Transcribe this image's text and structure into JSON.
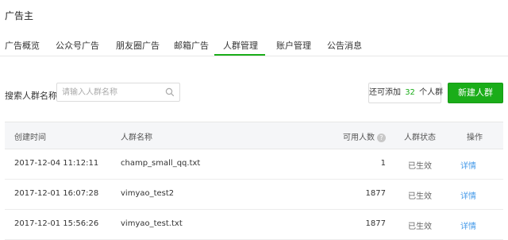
{
  "header": {
    "title": "广告主"
  },
  "nav": {
    "tabs": [
      {
        "label": "广告概览"
      },
      {
        "label": "公众号广告"
      },
      {
        "label": "朋友圈广告"
      },
      {
        "label": "邮箱广告"
      },
      {
        "label": "人群管理",
        "active": true
      },
      {
        "label": "账户管理"
      },
      {
        "label": "公告消息"
      }
    ]
  },
  "search": {
    "label": "搜索人群名称",
    "placeholder": "请输入人群名称"
  },
  "quota": {
    "prefix": "还可添加",
    "count": "32",
    "suffix": "个人群"
  },
  "new_button": {
    "label": "新建人群"
  },
  "table": {
    "headers": {
      "created": "创建时间",
      "name": "人群名称",
      "available": "可用人数",
      "status": "人群状态",
      "action": "操作"
    },
    "rows": [
      {
        "created": "2017-12-04 11:12:11",
        "name": "champ_small_qq.txt",
        "available": "1",
        "status": "已生效",
        "action": "详情"
      },
      {
        "created": "2017-12-01 16:07:28",
        "name": "vimyao_test2",
        "available": "1877",
        "status": "已生效",
        "action": "详情"
      },
      {
        "created": "2017-12-01 15:56:26",
        "name": "vimyao_test.txt",
        "available": "1877",
        "status": "已生效",
        "action": "详情"
      }
    ]
  },
  "colors": {
    "accent": "#1aad19",
    "link": "#459ae9"
  },
  "icons": {
    "search": "search-icon",
    "help": "help-icon"
  }
}
